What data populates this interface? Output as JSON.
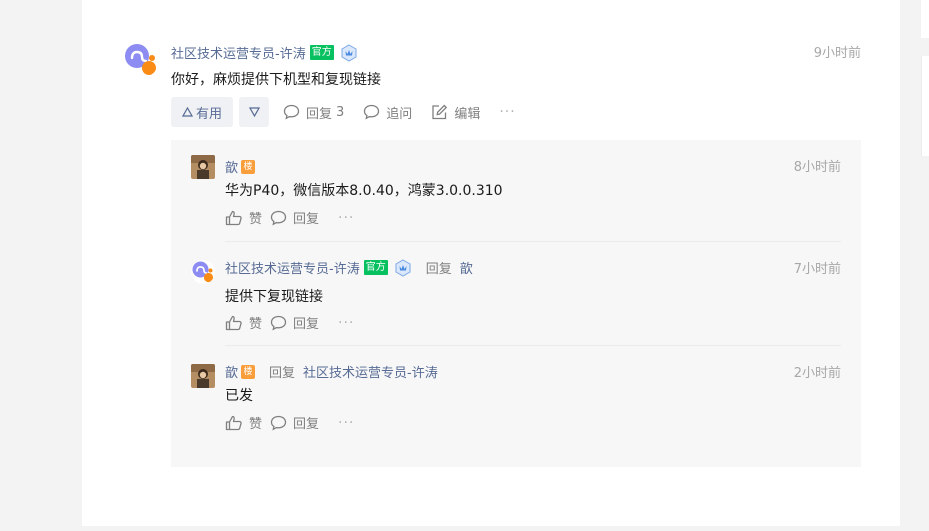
{
  "main_comment": {
    "author": "社区技术运营专员-许涛",
    "official_badge": "官方",
    "time": "9小时前",
    "content": "你好，麻烦提供下机型和复现链接",
    "actions": {
      "useful_label": "有用",
      "reply_label": "回复",
      "reply_count": "3",
      "follow_label": "追问",
      "edit_label": "编辑",
      "more_label": "···"
    }
  },
  "replies": [
    {
      "author": "歆",
      "floor_badge": "楼",
      "time": "8小时前",
      "content": "华为P40，微信版本8.0.40，鸿蒙3.0.0.310",
      "like_label": "赞",
      "reply_label": "回复",
      "more_label": "···"
    },
    {
      "author": "社区技术运营专员-许涛",
      "official_badge": "官方",
      "reply_word": "回复",
      "reply_to": "歆",
      "time": "7小时前",
      "content": "提供下复现链接",
      "like_label": "赞",
      "reply_label": "回复",
      "more_label": "···"
    },
    {
      "author": "歆",
      "floor_badge": "楼",
      "reply_word": "回复",
      "reply_to": "社区技术运营专员-许涛",
      "time": "2小时前",
      "content": "已发",
      "like_label": "赞",
      "reply_label": "回复",
      "more_label": "···"
    }
  ],
  "colors": {
    "link": "#576b95",
    "official": "#07c160",
    "floor": "#fa9d3b",
    "muted": "#a8a8a8",
    "panel": "#f7f7f7"
  },
  "icons": [
    "mini-program-logo-icon",
    "shield-badge-icon",
    "thumb-up-icon",
    "comment-bubble-icon",
    "edit-icon",
    "triangle-up-icon",
    "triangle-down-icon",
    "more-icon"
  ]
}
